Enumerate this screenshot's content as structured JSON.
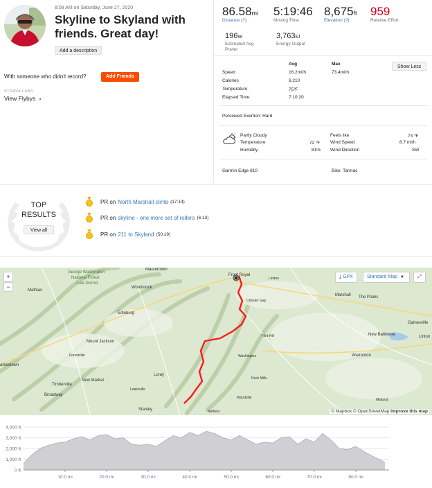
{
  "activity": {
    "date": "8:08 AM on Saturday, June 27, 2020",
    "title": "Skyline to Skyland with friends. Great day!",
    "add_description": "Add a description",
    "with_someone": "With someone who didn't record?",
    "add_friends": "Add Friends",
    "strava_labs": "STRAVA LABS",
    "view_flybys": "View Flybys"
  },
  "stats": {
    "distance": {
      "value": "86.58",
      "unit": "mi",
      "label": "Distance (?)"
    },
    "moving_time": {
      "value": "5:19:46",
      "label": "Moving Time"
    },
    "elevation": {
      "value": "8,675",
      "unit": "ft",
      "label": "Elevation (?)"
    },
    "relative_effort": {
      "value": "959",
      "label": "Relative Effort",
      "color": "#d0021b"
    },
    "power": {
      "value": "196",
      "unit": "W",
      "label": "Estimated Avg Power"
    },
    "energy": {
      "value": "3,763",
      "unit": "kJ",
      "label": "Energy Output"
    }
  },
  "table": {
    "col_avg": "Avg",
    "col_max": "Max",
    "show_less": "Show Less",
    "rows": [
      {
        "label": "Speed",
        "avg": "16.2mi/h",
        "max": "73.4mi/h"
      },
      {
        "label": "Calories",
        "avg": "6,210",
        "max": ""
      },
      {
        "label": "Temperature",
        "avg": "75℉",
        "max": ""
      },
      {
        "label": "Elapsed Time",
        "avg": "7:10:20",
        "max": ""
      }
    ],
    "perceived_exertion": "Perceived Exertion: Hard"
  },
  "weather": {
    "condition": "Partly Cloudy",
    "temperature_label": "Temperature",
    "temperature": "72 ℉",
    "humidity_label": "Humidity",
    "humidity": "81%",
    "feels_like_label": "Feels like",
    "feels_like": "73 ℉",
    "wind_speed_label": "Wind Speed",
    "wind_speed": "8.7 mi/h",
    "wind_direction_label": "Wind Direction",
    "wind_direction": "SW",
    "icon": "partly-cloudy-icon"
  },
  "gear": {
    "device": "Garmin Edge 810",
    "bike": "Bike: Tarmac"
  },
  "top_results": {
    "heading_1": "TOP",
    "heading_2": "RESULTS",
    "view_all": "View all",
    "items": [
      {
        "prefix": "PR on",
        "segment": "North Marshall climb",
        "time": "(17:14)"
      },
      {
        "prefix": "PR on",
        "segment": "skyline - one more set of rollers",
        "time": "(6:13)"
      },
      {
        "prefix": "PR on",
        "segment": "211 to Skyland",
        "time": "(50:19)"
      }
    ]
  },
  "map": {
    "gpx": "GPX",
    "map_type": "Standard Map",
    "zoom_in": "+",
    "zoom_out": "−",
    "attribution": "© Mapbox © OpenStreetMap",
    "improve": "Improve this map",
    "labels": {
      "gw": "George Washington",
      "nf": "National Forest",
      "lee": "- Lee District",
      "maurertown": "Maurertown",
      "woodstock": "Woodstock",
      "mathias": "Mathias",
      "edinburg": "Edinburg",
      "mount_jackson": "Mount Jackson",
      "forestville": "Forestville",
      "arkestown": "arkestown",
      "timberville": "Timberville",
      "new_market": "New Market",
      "broadway": "Broadway",
      "leaksville": "Leaksville",
      "luray": "Luray",
      "stanley": "Stanley",
      "front_royal": "Front Royal",
      "linden": "Linden",
      "chester_gap": "Chester Gap",
      "marshall": "Marshall",
      "the_plains": "The Plains",
      "flint_hill": "Flint Hill",
      "washington": "Washington",
      "rock_mills": "Rock Mills",
      "woodville": "Woodville",
      "nethers": "Nethers",
      "new_baltimore": "New Baltimore",
      "warrenton": "Warrenton",
      "gainesville": "Gainesville",
      "linton": "Linton",
      "midland": "Midland"
    }
  },
  "chart_data": {
    "type": "area",
    "xlabel": "",
    "ylabel": "",
    "x_ticks": [
      "10.0 mi",
      "20.0 mi",
      "30.0 mi",
      "40.0 mi",
      "50.0 mi",
      "60.0 mi",
      "70.0 mi",
      "80.0 mi"
    ],
    "x_tick_values": [
      10,
      20,
      30,
      40,
      50,
      60,
      70,
      80
    ],
    "y_ticks": [
      "0 ft",
      "1,000 ft",
      "2,000 ft",
      "3,000 ft",
      "4,000 ft"
    ],
    "y_tick_values": [
      0,
      1000,
      2000,
      3000,
      4000
    ],
    "xlim": [
      0,
      88
    ],
    "ylim": [
      0,
      4200
    ],
    "x": [
      0,
      2,
      4,
      6,
      8,
      10,
      12,
      14,
      16,
      18,
      20,
      22,
      24,
      26,
      28,
      30,
      32,
      34,
      36,
      38,
      40,
      42,
      44,
      46,
      48,
      50,
      52,
      54,
      56,
      58,
      60,
      62,
      64,
      66,
      68,
      70,
      72,
      74,
      76,
      78,
      80,
      82,
      84,
      86,
      87
    ],
    "values": [
      600,
      1400,
      2000,
      2300,
      2500,
      2600,
      2900,
      3100,
      2800,
      3200,
      3300,
      2900,
      3000,
      2400,
      2300,
      2400,
      2200,
      2700,
      3200,
      3000,
      3500,
      3200,
      3600,
      3400,
      3000,
      2800,
      3200,
      2800,
      2400,
      2600,
      2500,
      3000,
      3100,
      2400,
      2900,
      2600,
      3400,
      2800,
      2000,
      1900,
      2200,
      1700,
      1300,
      900,
      700
    ]
  }
}
